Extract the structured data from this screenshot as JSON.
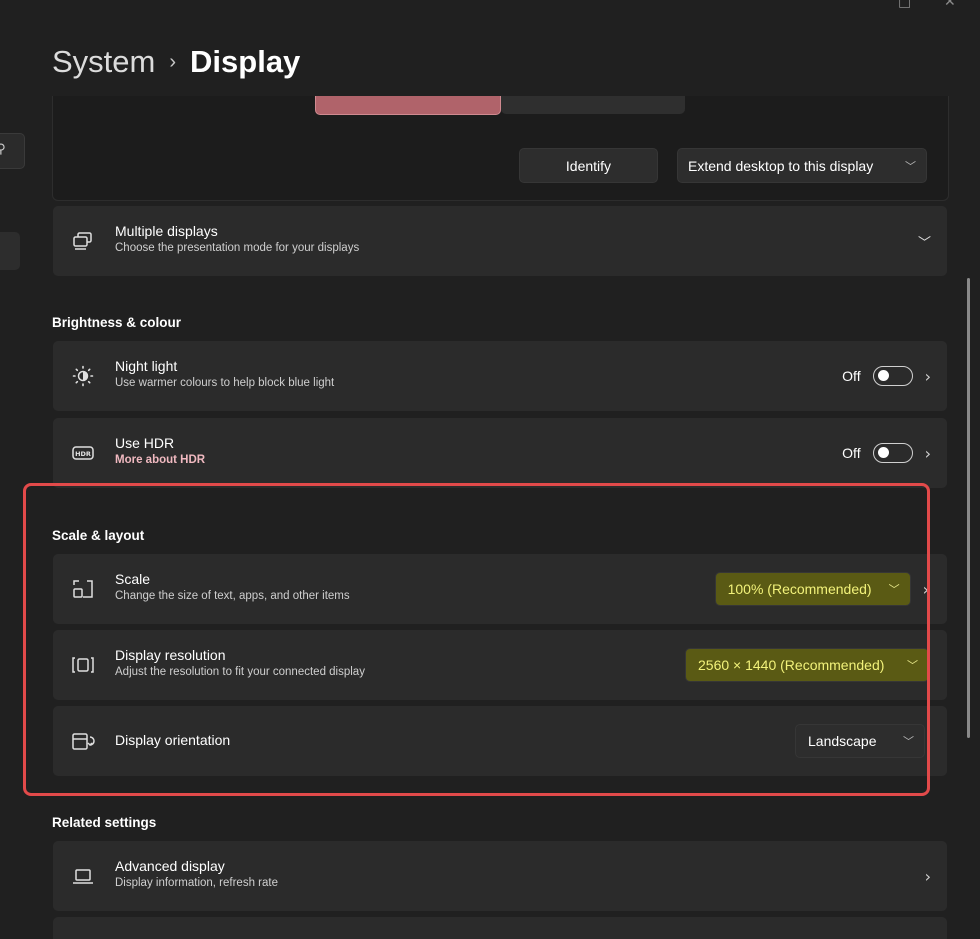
{
  "window": {
    "controls": [
      "□",
      "✕"
    ]
  },
  "breadcrumb": {
    "parent": "System",
    "separator": "›",
    "current": "Display"
  },
  "sidebar": {
    "search_icon": "search-icon"
  },
  "display_arrangement": {
    "identify_label": "Identify",
    "extend_label": "Extend desktop to this display"
  },
  "multiple_displays": {
    "title": "Multiple displays",
    "subtitle": "Choose the presentation mode for your displays"
  },
  "brightness": {
    "heading": "Brightness & colour",
    "night_light": {
      "title": "Night light",
      "subtitle": "Use warmer colours to help block blue light",
      "state": "Off"
    },
    "hdr": {
      "title": "Use HDR",
      "subtitle": "More about HDR",
      "state": "Off"
    }
  },
  "scale_layout": {
    "heading": "Scale & layout",
    "scale": {
      "title": "Scale",
      "subtitle": "Change the size of text, apps, and other items",
      "value": "100% (Recommended)"
    },
    "resolution": {
      "title": "Display resolution",
      "subtitle": "Adjust the resolution to fit your connected display",
      "value": "2560 × 1440 (Recommended)"
    },
    "orientation": {
      "title": "Display orientation",
      "value": "Landscape"
    }
  },
  "related": {
    "heading": "Related settings",
    "advanced": {
      "title": "Advanced display",
      "subtitle": "Display information, refresh rate"
    }
  },
  "colors": {
    "background": "#202020",
    "card": "#2b2b2b",
    "annotation_box": "#e24a4a",
    "highlight": "#f2f27a",
    "link": "#f0b9c0"
  }
}
